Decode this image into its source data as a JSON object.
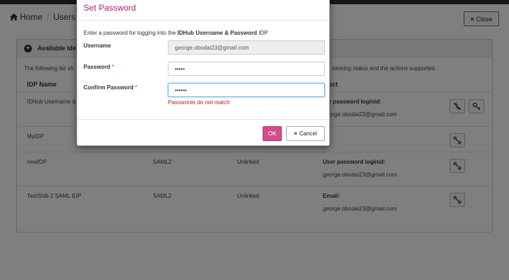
{
  "breadcrumb": {
    "home": "Home",
    "separator": "/",
    "current": "Users"
  },
  "header": {
    "close_label": "Close",
    "close_icon": "×"
  },
  "panel": {
    "title": "Available Ide",
    "description": "The following list sh",
    "description_tail": "isioning status and the actions supported."
  },
  "table": {
    "columns": [
      "IDP Name",
      "oject"
    ],
    "rows": [
      {
        "name": "IDHub Username &",
        "protocol": "",
        "status": "",
        "action_label": "ser password loginid:",
        "action_value": "george.obodai23@gmail.com",
        "buttons": [
          "unlink-icon",
          "key-icon"
        ]
      },
      {
        "name": "MyIDP",
        "protocol": "",
        "status": "",
        "action_label": "",
        "action_value": "",
        "buttons": [
          "link-icon"
        ]
      },
      {
        "name": "newIDP",
        "protocol": "SAML2",
        "status": "Unlinked",
        "action_label": "User password loginid:",
        "action_value": "george.obodai23@gmail.com",
        "buttons": [
          "link-icon"
        ]
      },
      {
        "name": "TestShib 2 SAML IDP",
        "protocol": "SAML2",
        "status": "Unlinked",
        "action_label": "Email:",
        "action_value": "george.obodai23@gmail.com",
        "buttons": [
          "link-icon"
        ]
      }
    ]
  },
  "modal": {
    "title": "Set Password",
    "intro_prefix": "Enter a password for logging into the",
    "intro_bold": "IDHub Username & Password",
    "intro_suffix": "IDP",
    "username_label": "Username",
    "username_value": "george.obodai23@gmail.com",
    "password_label": "Password",
    "password_value": "•••••",
    "confirm_label": "Confirm Password",
    "confirm_value": "••••••",
    "required_mark": "*",
    "error": "Passwords do not match",
    "ok_label": "OK",
    "cancel_label": "Cancel",
    "cancel_icon": "×"
  },
  "colors": {
    "accent": "#a8236b",
    "ok_button": "#d24d8a",
    "error": "#b32020",
    "focus": "#66afe9"
  }
}
